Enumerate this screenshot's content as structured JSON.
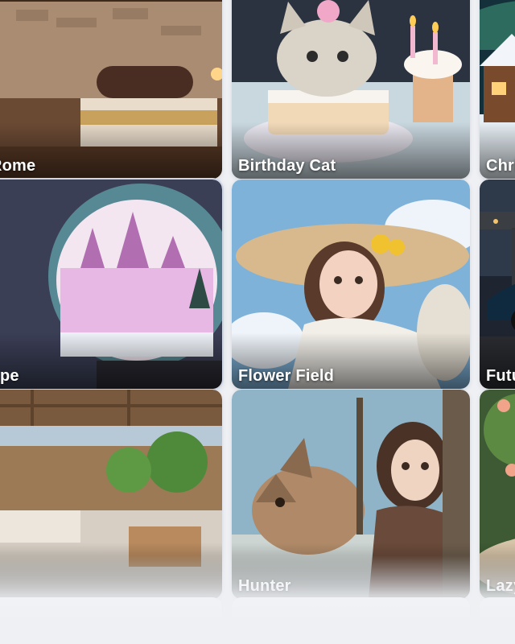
{
  "gallery": {
    "cards": [
      {
        "label": "Rome",
        "scene": "rome-bedroom-thumbnail"
      },
      {
        "label": "Birthday Cat",
        "scene": "birthday-cat-thumbnail"
      },
      {
        "label": "Christmas",
        "scene": "christmas-cabin-thumbnail"
      },
      {
        "label": "pe",
        "scene": "snow-globe-castle-thumbnail",
        "selected": true
      },
      {
        "label": "Flower Field",
        "scene": "flower-field-girl-thumbnail"
      },
      {
        "label": "Futuristic Car",
        "scene": "futuristic-car-thumbnail"
      },
      {
        "label": "",
        "scene": "patio-garden-thumbnail"
      },
      {
        "label": "Hunter",
        "scene": "hunter-wolf-thumbnail"
      },
      {
        "label": "Lazy Peach",
        "scene": "peach-drink-thumbnail"
      }
    ]
  },
  "colors": {
    "page_background": "#eef0f4",
    "card_label": "#ffffff"
  }
}
